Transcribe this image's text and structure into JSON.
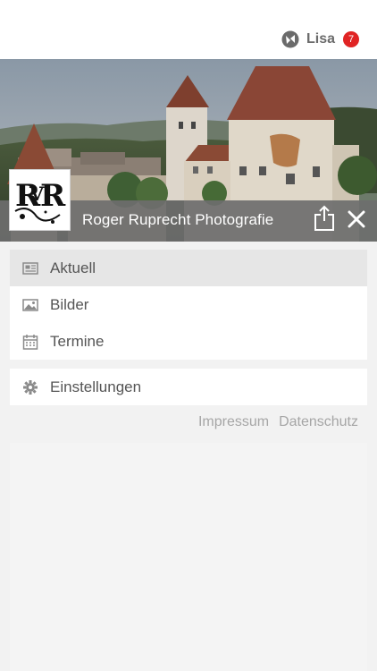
{
  "header": {
    "user_name": "Lisa",
    "notification_count": "7"
  },
  "site": {
    "title": "Roger Ruprecht Photografie"
  },
  "menu": {
    "items": [
      {
        "label": "Aktuell",
        "icon": "newspaper-icon",
        "active": true
      },
      {
        "label": "Bilder",
        "icon": "image-icon",
        "active": false
      },
      {
        "label": "Termine",
        "icon": "calendar-icon",
        "active": false
      }
    ],
    "settings_label": "Einstellungen"
  },
  "footer": {
    "impressum": "Impressum",
    "datenschutz": "Datenschutz"
  },
  "colors": {
    "badge": "#e02424",
    "titlebar": "#6e6e6e",
    "active_item": "#e6e6e6"
  }
}
